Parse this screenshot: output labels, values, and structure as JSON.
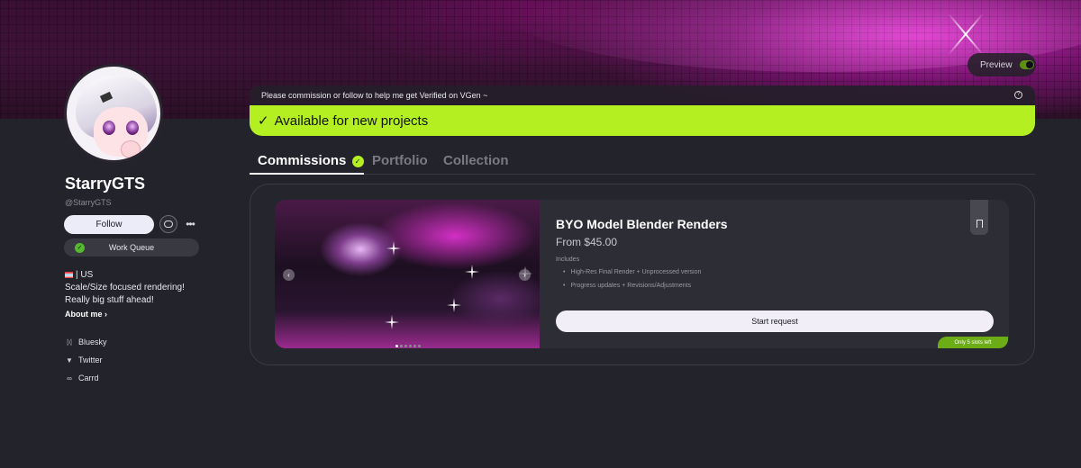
{
  "banner": {
    "preview_label": "Preview"
  },
  "profile": {
    "name": "StarryGTS",
    "handle": "@StarryGTS",
    "follow_label": "Follow",
    "more_label": "•••",
    "work_queue_label": "Work Queue",
    "bio_lines": [
      "| US",
      "Scale/Size focused rendering!",
      "Really big stuff ahead!"
    ],
    "about_label": "About me",
    "links": [
      {
        "label": "Bluesky",
        "icon": "butterfly-icon"
      },
      {
        "label": "Twitter",
        "icon": "bird-icon"
      },
      {
        "label": "Carrd",
        "icon": "link-icon"
      }
    ]
  },
  "notice": {
    "text": "Please commission or follow to help me get Verified on VGen ~",
    "help": "?"
  },
  "status": {
    "text": "Available for new projects",
    "color": "#b4ef22"
  },
  "tabs": [
    {
      "label": "Commissions",
      "active": true
    },
    {
      "label": "Portfolio",
      "active": false
    },
    {
      "label": "Collection",
      "active": false
    }
  ],
  "commission": {
    "title": "BYO Model Blender Renders",
    "price": "From $45.00",
    "includes_label": "Includes",
    "includes": [
      "High-Res Final Render + Unprocessed version",
      "Progress updates + Revisions/Adjustments"
    ],
    "start_label": "Start request",
    "slots_label": "Only 5 slots left",
    "image_count": 6,
    "current_image": 1
  }
}
